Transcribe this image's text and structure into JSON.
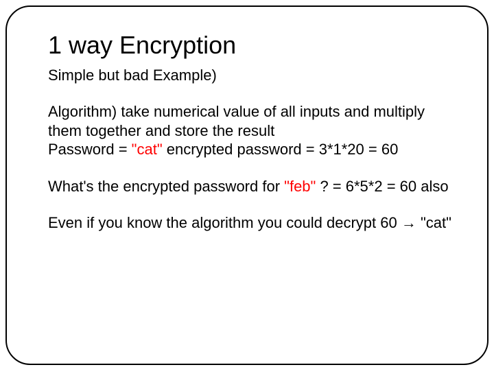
{
  "slide": {
    "title": "1 way Encryption",
    "subtitle": "Simple but bad Example)",
    "algorithm_line": "Algorithm) take numerical value of all inputs and multiply them together and store the result",
    "password_pre": "Password = ",
    "password_cat": "\"cat\"",
    "password_post": " encrypted password = 3*1*20 = 60",
    "feb_pre": "What's the encrypted password for ",
    "feb_word": "\"feb\"",
    "feb_post": " ? = 6*5*2 = 60 also",
    "decrypt_pre": "Even if you know the algorithm you could decrypt 60 ",
    "decrypt_arrow": "→",
    "decrypt_post": " \"cat\""
  }
}
